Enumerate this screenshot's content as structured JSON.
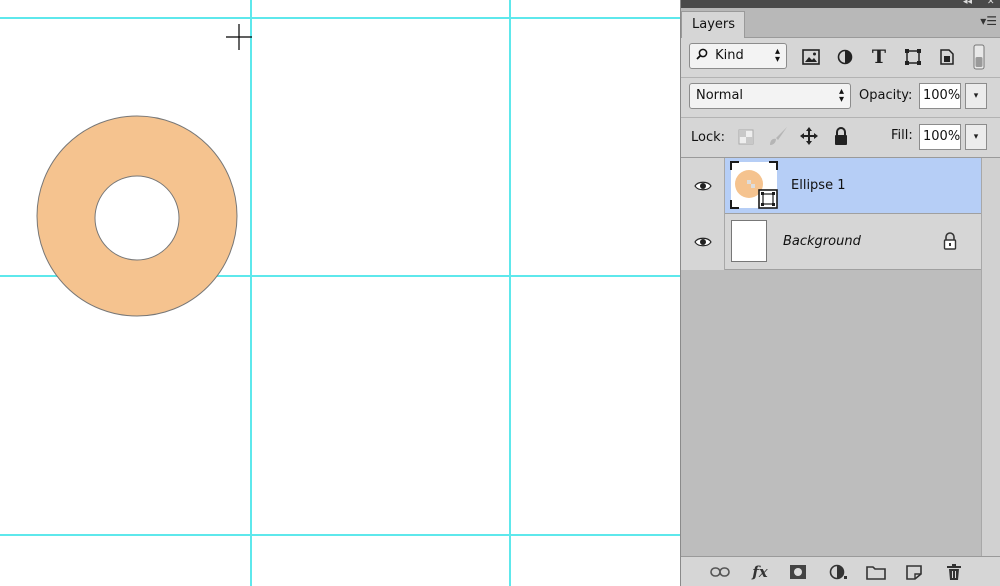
{
  "canvas": {
    "background": "#ffffff",
    "guide_color": "#5ee8ec",
    "shape": {
      "fill": "#f5c38f",
      "stroke": "#777777"
    }
  },
  "layers_panel": {
    "tab_label": "Layers",
    "filter": {
      "kind_label": "Kind"
    },
    "blend_mode": "Normal",
    "opacity_label": "Opacity:",
    "opacity_value": "100%",
    "lock_label": "Lock:",
    "fill_label": "Fill:",
    "fill_value": "100%",
    "selected_color": "#b6cef6",
    "layers": [
      {
        "name": "Ellipse 1",
        "selected": true
      },
      {
        "name": "Background",
        "locked": true
      }
    ]
  }
}
